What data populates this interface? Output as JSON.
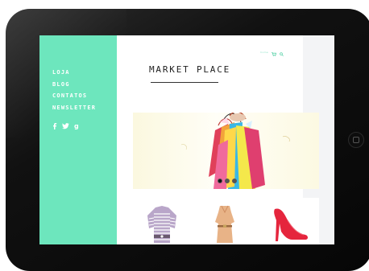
{
  "sidebar": {
    "nav": [
      {
        "label": "LOJA"
      },
      {
        "label": "BLOG"
      },
      {
        "label": "CONTATOS"
      },
      {
        "label": "NEWSLETTER"
      }
    ],
    "social": [
      "facebook-icon",
      "twitter-icon",
      "google-icon"
    ]
  },
  "header": {
    "topbar_text": "home",
    "title": "MARKET PLACE"
  },
  "hero": {
    "slides": 3,
    "active_slide": 1
  },
  "products": [
    "striped-sweater",
    "beige-dress",
    "red-heel"
  ],
  "colors": {
    "accent": "#6de6bd",
    "background": "#f3f4f6"
  }
}
